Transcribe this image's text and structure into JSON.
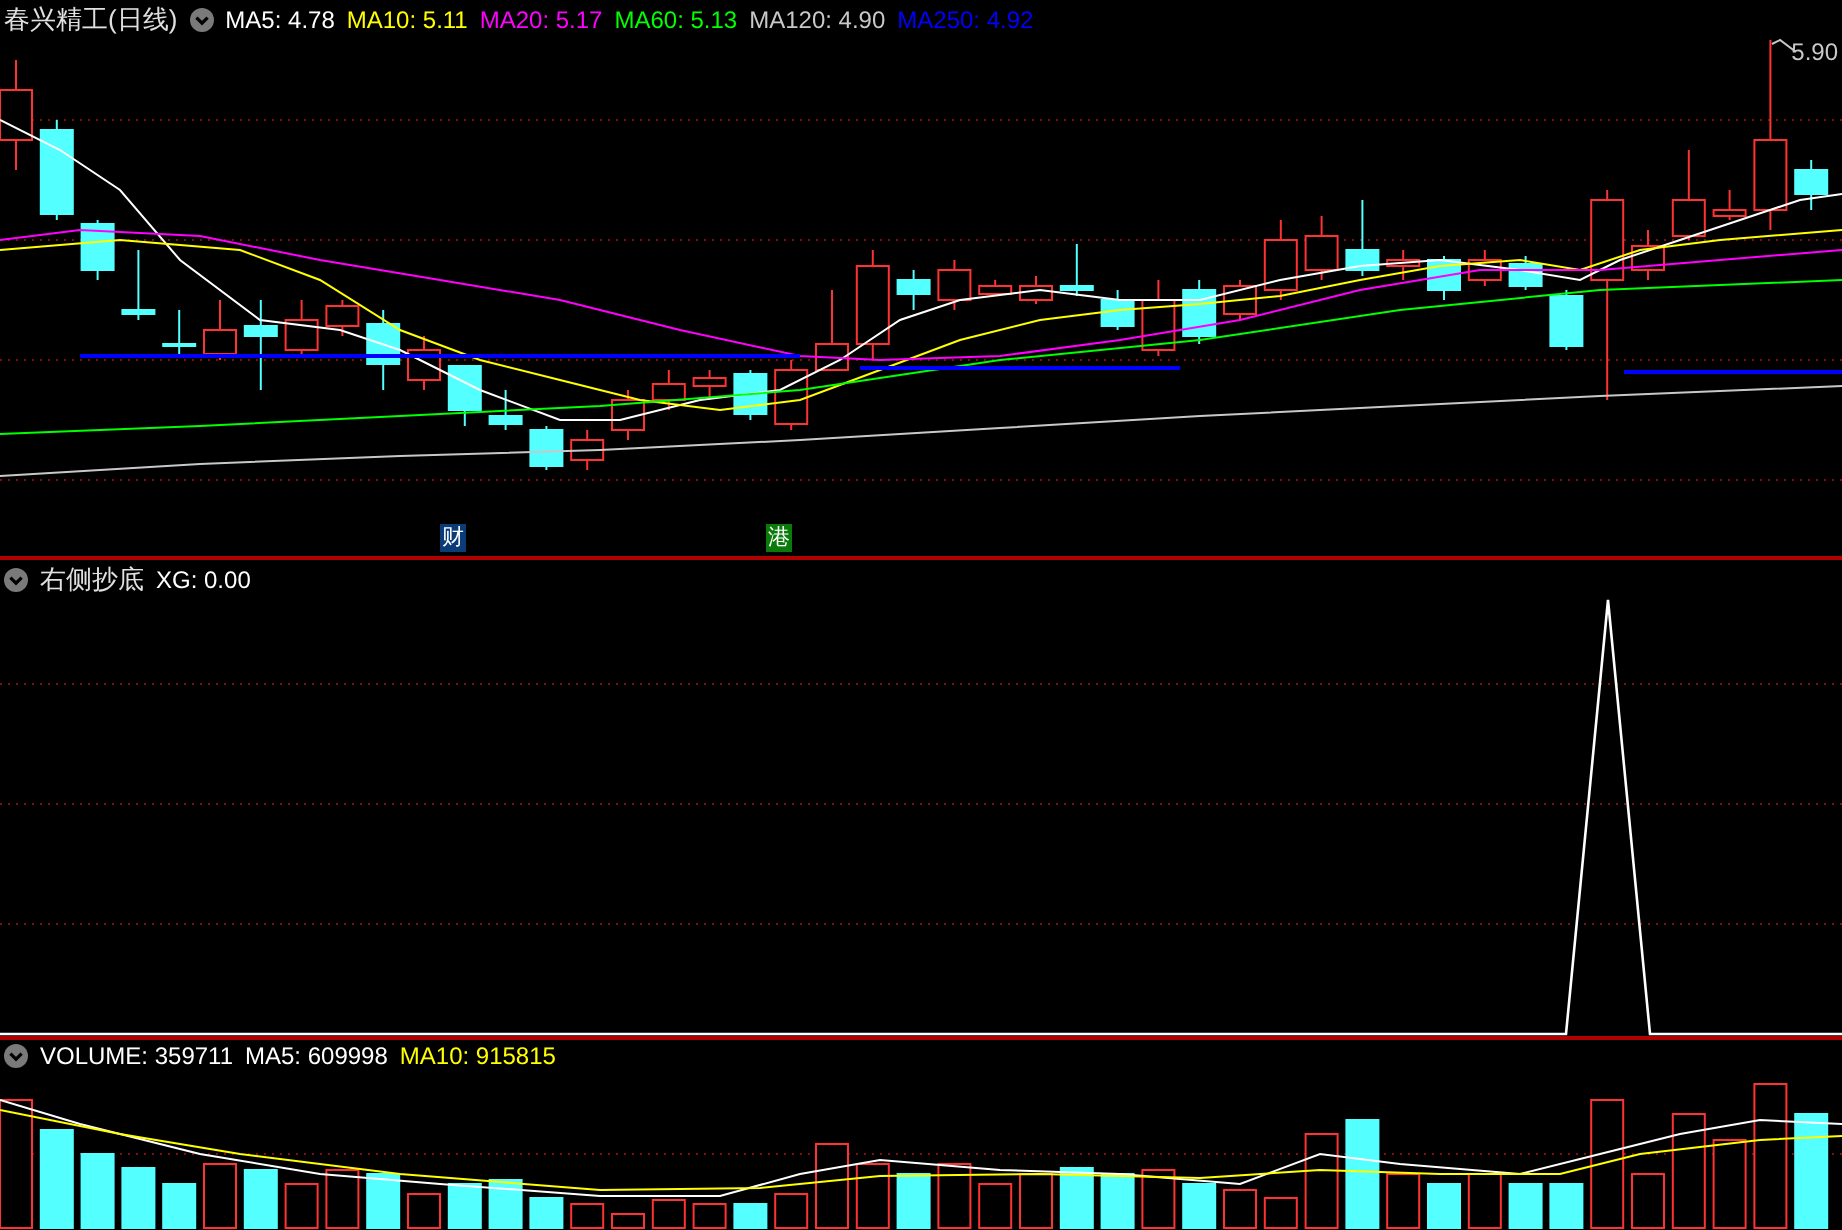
{
  "price_panel": {
    "title": "春兴精工(日线)",
    "indicators": [
      {
        "label": "MA5: 4.78",
        "color": "#ffffff"
      },
      {
        "label": "MA10: 5.11",
        "color": "#ffff00"
      },
      {
        "label": "MA20: 5.17",
        "color": "#ff00ff"
      },
      {
        "label": "MA60: 5.13",
        "color": "#00ff00"
      },
      {
        "label": "MA120: 4.90",
        "color": "#c8c8c8"
      },
      {
        "label": "MA250: 4.92",
        "color": "#0000ff"
      }
    ],
    "high_label": "5.90",
    "event_markers": [
      {
        "label": "财",
        "color": "#0c3c78"
      },
      {
        "label": "港",
        "color": "#0a7a0a"
      }
    ]
  },
  "signal_panel": {
    "title": "右侧抄底",
    "indicators": [
      {
        "label": "XG: 0.00",
        "color": "#ffffff"
      }
    ]
  },
  "volume_panel": {
    "indicators": [
      {
        "label": "VOLUME: 359711",
        "color": "#ffffff"
      },
      {
        "label": "MA5: 609998",
        "color": "#ffffff"
      },
      {
        "label": "MA10: 915815",
        "color": "#ffff00"
      }
    ]
  }
}
